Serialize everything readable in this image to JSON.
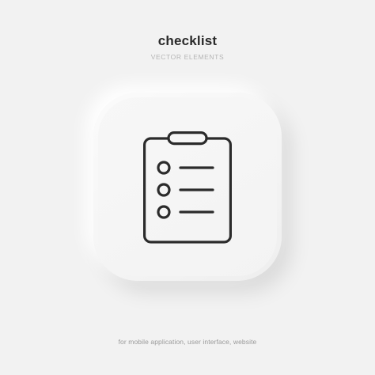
{
  "header": {
    "title": "checklist",
    "subtitle": "VECTOR ELEMENTS"
  },
  "icon": {
    "name": "clipboard-checklist-icon",
    "stroke_color": "#2b2b2b",
    "tile_color": "#f6f6f6"
  },
  "footer": {
    "text": "for mobile application, user interface, website"
  },
  "colors": {
    "background": "#f2f2f2",
    "title": "#2b2b2b",
    "subtitle": "#b5b5b5",
    "footer": "#9a9a9a"
  }
}
